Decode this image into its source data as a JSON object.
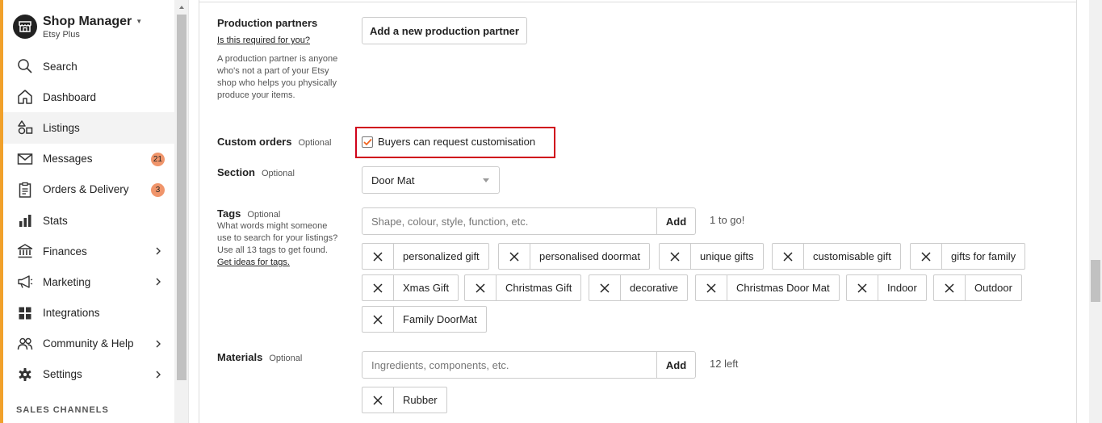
{
  "sidebar": {
    "brand_title": "Shop Manager",
    "brand_subtitle": "Etsy Plus",
    "items": [
      {
        "label": "Search",
        "icon": "search-icon"
      },
      {
        "label": "Dashboard",
        "icon": "home-icon"
      },
      {
        "label": "Listings",
        "icon": "shapes-icon",
        "active": true
      },
      {
        "label": "Messages",
        "icon": "mail-icon",
        "badge": "21"
      },
      {
        "label": "Orders & Delivery",
        "icon": "clipboard-icon",
        "badge": "3"
      },
      {
        "label": "Stats",
        "icon": "bar-chart-icon"
      },
      {
        "label": "Finances",
        "icon": "bank-icon",
        "chevron": true
      },
      {
        "label": "Marketing",
        "icon": "megaphone-icon",
        "chevron": true
      },
      {
        "label": "Integrations",
        "icon": "grid-icon"
      },
      {
        "label": "Community & Help",
        "icon": "people-icon",
        "chevron": true
      },
      {
        "label": "Settings",
        "icon": "gear-icon",
        "chevron": true
      }
    ],
    "section_heading": "SALES CHANNELS"
  },
  "form": {
    "production_partners": {
      "label": "Production partners",
      "help_link": "Is this required for you?",
      "help_text": "A production partner is anyone who's not a part of your Etsy shop who helps you physically produce your items.",
      "button": "Add a new production partner"
    },
    "custom_orders": {
      "label": "Custom orders",
      "optional": "Optional",
      "checkbox_label": "Buyers can request customisation",
      "checked": true
    },
    "section": {
      "label": "Section",
      "optional": "Optional",
      "value": "Door Mat"
    },
    "tags": {
      "label": "Tags",
      "optional": "Optional",
      "help_text": "What words might someone use to search for your listings? Use all 13 tags to get found.",
      "help_link": "Get ideas for tags.",
      "placeholder": "Shape, colour, style, function, etc.",
      "add_label": "Add",
      "counter": "1 to go!",
      "items": [
        "personalized gift",
        "personalised doormat",
        "unique gifts",
        "customisable gift",
        "gifts for family",
        "Xmas Gift",
        "Christmas Gift",
        "decorative",
        "Christmas Door Mat",
        "Indoor",
        "Outdoor",
        "Family DoorMat"
      ]
    },
    "materials": {
      "label": "Materials",
      "optional": "Optional",
      "placeholder": "Ingredients, components, etc.",
      "add_label": "Add",
      "counter": "12 left",
      "items": [
        "Rubber"
      ]
    }
  },
  "colors": {
    "accent": "#f1a12b",
    "badge": "#f0956b",
    "highlight": "#d0021b",
    "checkbox_check": "#f1641e"
  }
}
